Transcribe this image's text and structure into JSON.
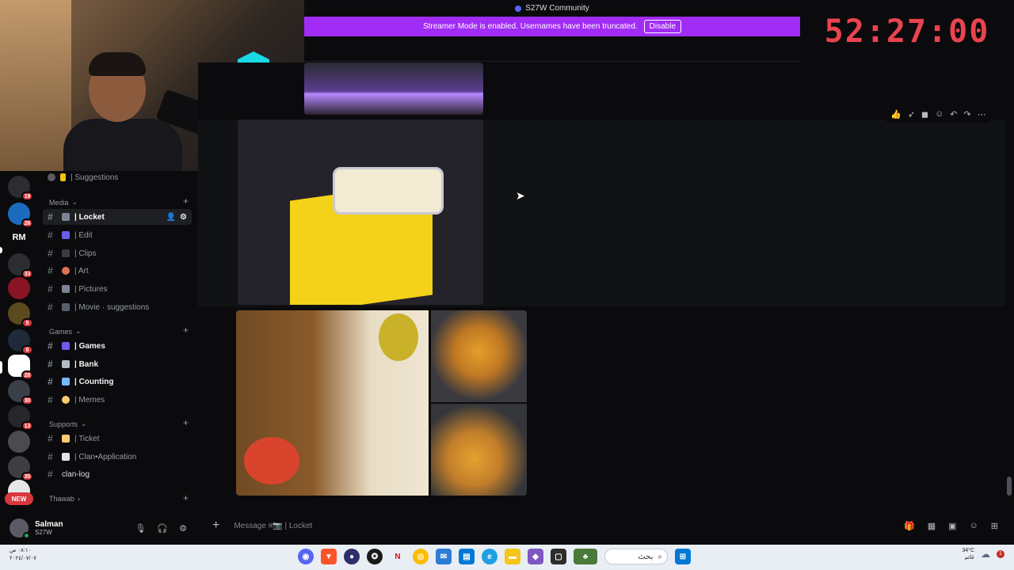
{
  "window": {
    "title": "S27W Community"
  },
  "banner": {
    "text": "Streamer Mode is enabled. Usernames have been truncated.",
    "button": "Disable"
  },
  "timer": {
    "value": "52:27:00"
  },
  "servers": [
    {
      "badge": "19"
    },
    {
      "badge": "26"
    },
    {
      "label": "RM"
    },
    {
      "badge": "33"
    },
    {
      "badge": ""
    },
    {
      "badge": "5"
    },
    {
      "badge": "6"
    },
    {
      "badge": "28"
    },
    {
      "badge": "30"
    },
    {
      "badge": "13"
    },
    {
      "badge": ""
    },
    {
      "badge": "35"
    }
  ],
  "new_badge": "NEW",
  "sidebar": {
    "top_channel": {
      "label": "| Suggestions"
    },
    "categories": {
      "media": "Media",
      "games": "Games",
      "supports": "Supports",
      "thawab": "Thawab"
    },
    "media_channels": [
      {
        "label": "| Locket",
        "active": true
      },
      {
        "label": "| Edit"
      },
      {
        "label": "| Clips"
      },
      {
        "label": "| Art"
      },
      {
        "label": "| Pictures"
      },
      {
        "label": "| Movie · suggestions"
      }
    ],
    "games_channels": [
      {
        "label": "| Games"
      },
      {
        "label": "| Bank"
      },
      {
        "label": "| Counting"
      },
      {
        "label": "| Memes"
      }
    ],
    "supports_channels": [
      {
        "label": "| Ticket"
      },
      {
        "label": "| Clan•Application"
      },
      {
        "label": "clan-log"
      }
    ]
  },
  "user": {
    "name": "Salman",
    "status": "S27W"
  },
  "composer": {
    "placeholder": "Message #📷 | Locket"
  },
  "taskbar": {
    "left_line1": "٠٨:١٠ ص",
    "left_line2": "٢٠٢٤/٠٧/٠٧",
    "search_text": "بحث",
    "weather_temp": "34°C",
    "weather_desc": "غائم",
    "notifications": "1"
  },
  "colors": {
    "accent": "#5865f2",
    "banner": "#a02cf5",
    "timer": "#e9444f",
    "badge": "#da373c",
    "online": "#23a55a"
  }
}
